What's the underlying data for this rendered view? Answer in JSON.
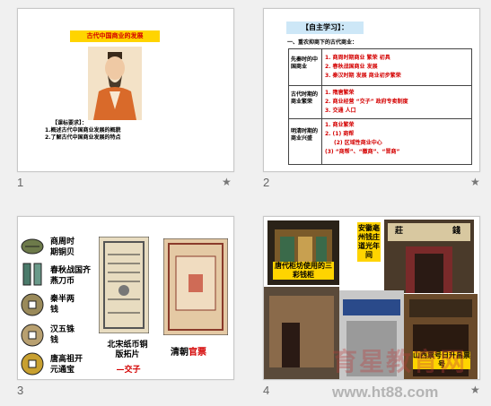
{
  "colors": {
    "background": "#f0f0f0",
    "title_yellow": "#ffd400",
    "title_red": "#d40000",
    "header_blue": "#cde7f7"
  },
  "slides": [
    {
      "number": "1",
      "title": "古代中国商业的发展",
      "goals_title": "【课标要求】：",
      "goals": [
        "1.概述古代中国商业发展的概貌",
        "2.了解古代中国商业发展的特点"
      ]
    },
    {
      "number": "2",
      "header": "【自主学习】：",
      "subheader": "一、重农抑商下的古代商业：",
      "rows": [
        {
          "label": "先秦时的中国商业",
          "lines": [
            "1. 商周时期商业 繁荣 初具",
            "2. 春秋战国商业 发展",
            "3. 秦汉时期 发展 商业初步繁荣"
          ]
        },
        {
          "label": "古代时期的商业繁荣",
          "lines": [
            "1. 隋唐繁荣",
            "2. 商业经营 “交子” 政府专卖制度",
            "3. 交通 人口"
          ]
        },
        {
          "label": "明清时期的商业兴盛",
          "lines": [
            "1. 商业繁荣",
            "2. (1) 商帮",
            "(2) 区域性商业中心",
            "(3) “商帮”、“徽商”、“晋商”"
          ]
        }
      ]
    },
    {
      "number": "3",
      "coins": [
        {
          "label": "商周时期铜贝",
          "icon": "shell-coin-icon"
        },
        {
          "label": "春秋战国齐燕刀币",
          "icon": "knife-coin-icon"
        },
        {
          "label": "秦半两钱",
          "icon": "round-coin-icon"
        },
        {
          "label": "汉五铢钱",
          "icon": "square-hole-coin-icon"
        },
        {
          "label": "唐高祖开元通宝",
          "icon": "gold-coin-icon"
        }
      ],
      "note1": "北宋纸币铜版拓片",
      "note1_red": "—交子",
      "note2": "清朝",
      "note2_red": "官票"
    },
    {
      "number": "4",
      "caption_left": "唐代柜坊使用的三彩钱柜",
      "caption_mid": "安徽亳州钱庄道光年间",
      "caption_right": "山西票号日升昌票号",
      "sign_text": "莊",
      "sign_text2": "錢"
    }
  ],
  "watermark": {
    "big": "育星教育网",
    "url": "www.ht88.com"
  }
}
